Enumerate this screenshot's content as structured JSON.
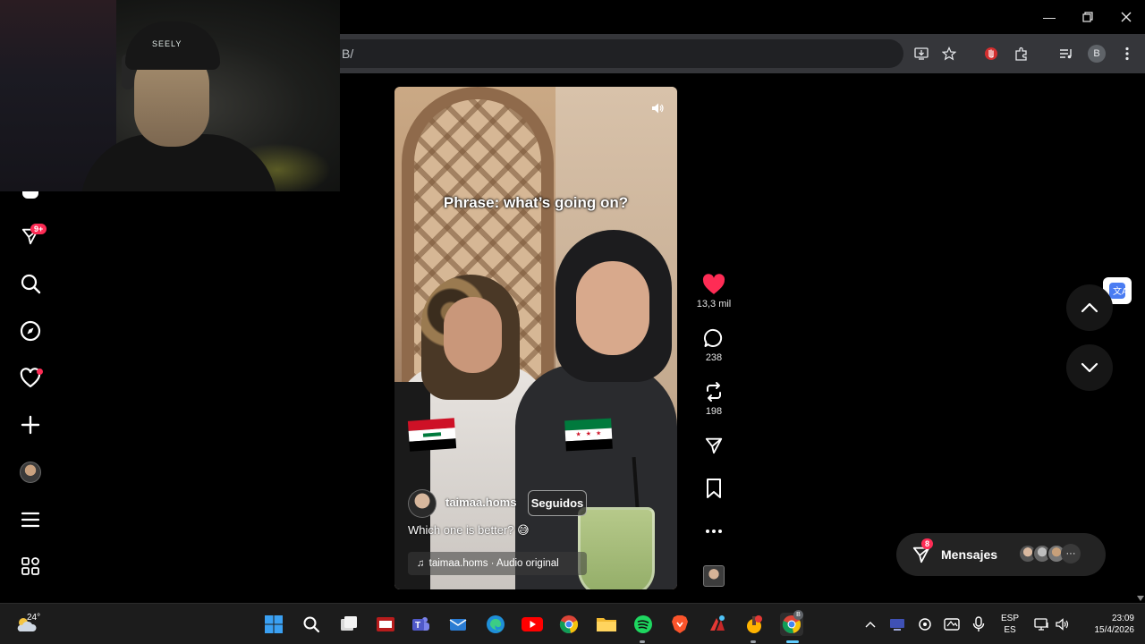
{
  "browser": {
    "url_fragment": "B/",
    "profile_initial": "B"
  },
  "webcam": {
    "cap_text": "SEELY"
  },
  "sidebar": {
    "messages_badge": "9+"
  },
  "video": {
    "phrase": "Phrase: what’s going on?",
    "author": "taimaa.homs",
    "follow_label": "Seguidos",
    "caption": "Which one is better? 😅",
    "music": "taimaa.homs · Audio original"
  },
  "actions": {
    "likes": "13,3 mil",
    "comments": "238",
    "reposts": "198"
  },
  "messages": {
    "label": "Mensajes",
    "badge": "8"
  },
  "taskbar": {
    "temperature": "24°",
    "lang_top": "ESP",
    "lang_bottom": "ES",
    "time": "23:09",
    "date": "15/4/2026",
    "chrome_badge": "B"
  },
  "colors": {
    "accent": "#fe2c55",
    "like": "#fe2c55",
    "background": "#000000"
  }
}
